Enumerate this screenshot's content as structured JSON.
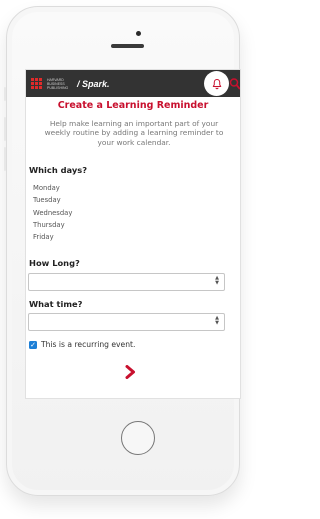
{
  "header": {
    "brand_tagline": "HARVARD BUSINESS PUBLISHING",
    "brand_name": "/ Spark."
  },
  "reminder": {
    "title": "Create a Learning Reminder",
    "description": "Help make learning an important part of your weekly routine by adding a learning reminder to your work calendar.",
    "days_label": "Which days?",
    "days": [
      "Monday",
      "Tuesday",
      "Wednesday",
      "Thursday",
      "Friday"
    ],
    "how_long_label": "How Long?",
    "how_long_value": "",
    "what_time_label": "What time?",
    "what_time_value": "",
    "recurring_label": "This is a recurring event.",
    "recurring_checked": true
  },
  "colors": {
    "accent": "#c8102e",
    "appbar": "#333333",
    "checkbox": "#1d7fd6"
  }
}
